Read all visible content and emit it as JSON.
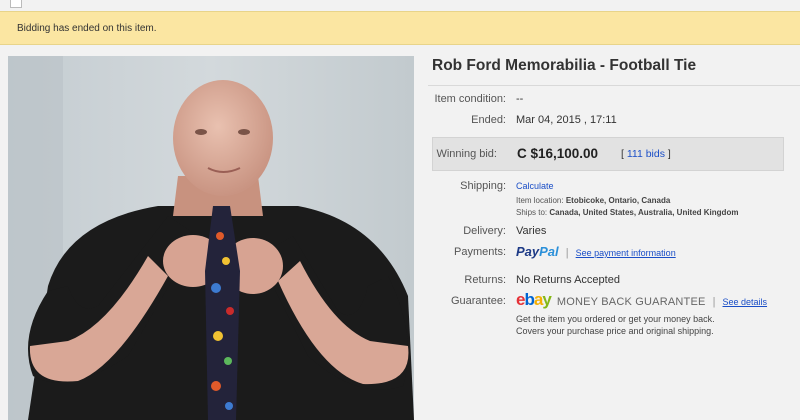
{
  "banner": {
    "text": "Bidding has ended on this item."
  },
  "item": {
    "title": "Rob Ford Memorabilia - Football Tie",
    "condition_label": "Item condition:",
    "condition_value": "--",
    "ended_label": "Ended:",
    "ended_value": "Mar 04, 2015 , 17:11",
    "winning_bid_label": "Winning bid:",
    "winning_bid_value": "C $16,100.00",
    "bids_open": "[ ",
    "bids_link": "111 bids",
    "bids_close": " ]"
  },
  "shipping": {
    "label": "Shipping:",
    "calculate": "Calculate",
    "location_label": "Item location:",
    "location_value": "Etobicoke, Ontario, Canada",
    "ships_to_label": "Ships to:",
    "ships_to_value": "Canada, United States, Australia, United Kingdom"
  },
  "delivery": {
    "label": "Delivery:",
    "value": "Varies"
  },
  "payments": {
    "label": "Payments:",
    "paypal_1": "Pay",
    "paypal_2": "Pal",
    "separator": "|",
    "see_payment": "See payment information"
  },
  "returns": {
    "label": "Returns:",
    "value": "No Returns Accepted"
  },
  "guarantee": {
    "label": "Guarantee:",
    "logo_e": "e",
    "logo_b": "b",
    "logo_a": "a",
    "logo_y": "y",
    "mbg_text": "MONEY BACK GUARANTEE",
    "separator": "|",
    "see_details": "See details",
    "line1": "Get the item you ordered or get your money back.",
    "line2": "Covers your purchase price and original shipping."
  },
  "colors": {
    "banner_bg": "#fbe6a2",
    "link": "#1a4ec7",
    "bid_box_bg": "#e2e2e2"
  }
}
